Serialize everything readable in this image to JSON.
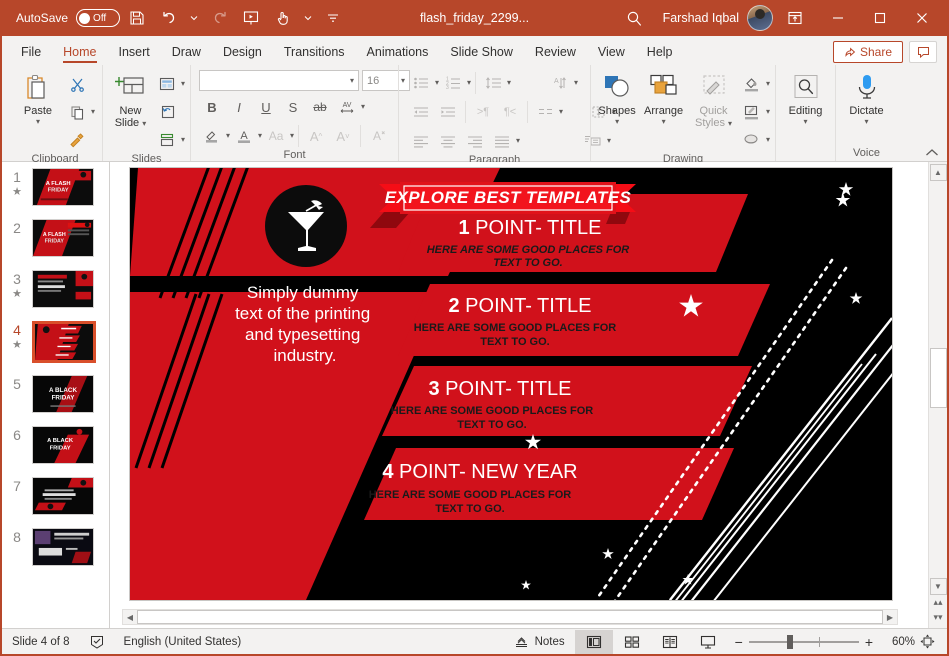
{
  "titlebar": {
    "autosave_label": "AutoSave",
    "autosave_state": "Off",
    "save_icon": "save-icon",
    "undo_icon": "undo-icon",
    "redo_icon": "redo-icon",
    "present_icon": "start-presentation-icon",
    "touch_icon": "touch-mode-icon",
    "customize_icon": "customize-quick-access-icon",
    "document_title": "flash_friday_2299...",
    "search_icon": "search-icon",
    "user_name": "Farshad Iqbal",
    "ribbon_display_icon": "ribbon-display-options-icon",
    "minimize_label": "—",
    "maximize_label": "☐",
    "close_label": "✕"
  },
  "tabs": [
    {
      "label": "File",
      "active": false
    },
    {
      "label": "Home",
      "active": true
    },
    {
      "label": "Insert",
      "active": false
    },
    {
      "label": "Draw",
      "active": false
    },
    {
      "label": "Design",
      "active": false
    },
    {
      "label": "Transitions",
      "active": false
    },
    {
      "label": "Animations",
      "active": false
    },
    {
      "label": "Slide Show",
      "active": false
    },
    {
      "label": "Review",
      "active": false
    },
    {
      "label": "View",
      "active": false
    },
    {
      "label": "Help",
      "active": false
    }
  ],
  "tabs_right": {
    "share_label": "Share",
    "share_icon": "share-icon",
    "comment_icon": "comment-icon"
  },
  "ribbon": {
    "accent_color": "#b7472a",
    "clipboard": {
      "label": "Clipboard",
      "paste_label": "Paste",
      "paste_icon": "paste-icon",
      "cut_icon": "cut-scissors-icon",
      "copy_icon": "copy-icon",
      "format_painter_icon": "format-painter-icon",
      "launcher_icon": "dialog-launcher-icon"
    },
    "slides": {
      "label": "Slides",
      "new_slide_label_line1": "New",
      "new_slide_label_line2": "Slide",
      "new_slide_icon": "new-slide-icon",
      "layout_icon": "slide-layout-icon",
      "reset_icon": "reset-slide-icon",
      "section_icon": "section-icon"
    },
    "font": {
      "label": "Font",
      "font_name_value": "",
      "font_size_value": "16",
      "bold": "B",
      "italic": "I",
      "underline": "U",
      "shadow": "S",
      "strikethrough": "ab",
      "char_spacing_icon": "character-spacing-icon",
      "text_highlight_icon": "text-highlight-icon",
      "font_color_icon": "font-color-icon",
      "change_case_label": "Aa",
      "increase_size_label": "A",
      "decrease_size_label": "A",
      "clear_format_icon": "clear-formatting-icon",
      "launcher_icon": "dialog-launcher-icon"
    },
    "paragraph": {
      "label": "Paragraph",
      "bullets_icon": "bullets-icon",
      "numbering_icon": "numbering-icon",
      "line_spacing_icon": "line-spacing-icon",
      "text_direction_icon": "text-direction-icon",
      "decrease_indent_icon": "decrease-indent-icon",
      "increase_indent_icon": "increase-indent-icon",
      "ltr_icon": "left-to-right-icon",
      "rtl_icon": "right-to-left-icon",
      "align_text_icon": "align-text-icon",
      "columns_icon": "columns-icon",
      "align_left_icon": "align-left-icon",
      "align_center_icon": "align-center-icon",
      "align_right_icon": "align-right-icon",
      "justify_icon": "justify-icon",
      "smartart_icon": "convert-to-smartart-icon",
      "launcher_icon": "dialog-launcher-icon"
    },
    "drawing": {
      "label": "Drawing",
      "shapes_label": "Shapes",
      "shapes_icon": "shapes-icon",
      "arrange_label": "Arrange",
      "arrange_icon": "arrange-icon",
      "quick_styles_label_line1": "Quick",
      "quick_styles_label_line2": "Styles",
      "quick_styles_icon": "quick-styles-icon",
      "shape_fill_icon": "shape-fill-icon",
      "shape_outline_icon": "shape-outline-icon",
      "shape_effects_icon": "shape-effects-icon",
      "launcher_icon": "dialog-launcher-icon"
    },
    "editing": {
      "label": "",
      "editing_label": "Editing",
      "editing_icon": "find-magnifier-icon"
    },
    "voice": {
      "label": "Voice",
      "dictate_label": "Dictate",
      "dictate_icon": "microphone-icon"
    },
    "collapse_icon": "collapse-ribbon-icon"
  },
  "thumbnails": [
    {
      "number": "1",
      "has_star": true,
      "selected": false
    },
    {
      "number": "2",
      "has_star": false,
      "selected": false
    },
    {
      "number": "3",
      "has_star": true,
      "selected": false
    },
    {
      "number": "4",
      "has_star": true,
      "selected": true
    },
    {
      "number": "5",
      "has_star": false,
      "selected": false
    },
    {
      "number": "6",
      "has_star": false,
      "selected": false
    },
    {
      "number": "7",
      "has_star": false,
      "selected": false
    },
    {
      "number": "8",
      "has_star": false,
      "selected": false
    }
  ],
  "slide": {
    "bg_color": "#000000",
    "red": "#d1111b",
    "red_dark": "#b00c14",
    "ribbon_banner_text": "EXPLORE BEST TEMPLATES",
    "cocktail_icon": "cocktail-glass-icon",
    "body_text": "Simply dummy text of the printing and typesetting industry.",
    "points": [
      {
        "number": "1",
        "title": "POINT- TITLE",
        "subtitle": "HERE ARE SOME GOOD PLACES FOR TEXT TO GO."
      },
      {
        "number": "2",
        "title": "POINT- TITLE",
        "subtitle": "HERE ARE SOME GOOD PLACES FOR TEXT TO GO."
      },
      {
        "number": "3",
        "title": "POINT- TITLE",
        "subtitle": "HERE ARE SOME GOOD PLACES FOR TEXT TO GO."
      },
      {
        "number": "4",
        "title": "POINT- NEW YEAR",
        "subtitle": "HERE ARE SOME GOOD PLACES FOR TEXT TO GO."
      }
    ]
  },
  "statusbar": {
    "slide_counter": "Slide 4 of 8",
    "spellcheck_icon": "spellcheck-icon",
    "language": "English (United States)",
    "notes_label": "Notes",
    "notes_icon": "notes-icon",
    "view_normal_icon": "normal-view-icon",
    "view_sorter_icon": "slide-sorter-icon",
    "view_reading_icon": "reading-view-icon",
    "view_slideshow_icon": "slideshow-view-icon",
    "zoom_out_label": "−",
    "zoom_in_label": "+",
    "zoom_value": "60%",
    "fit_icon": "fit-slide-to-window-icon"
  }
}
